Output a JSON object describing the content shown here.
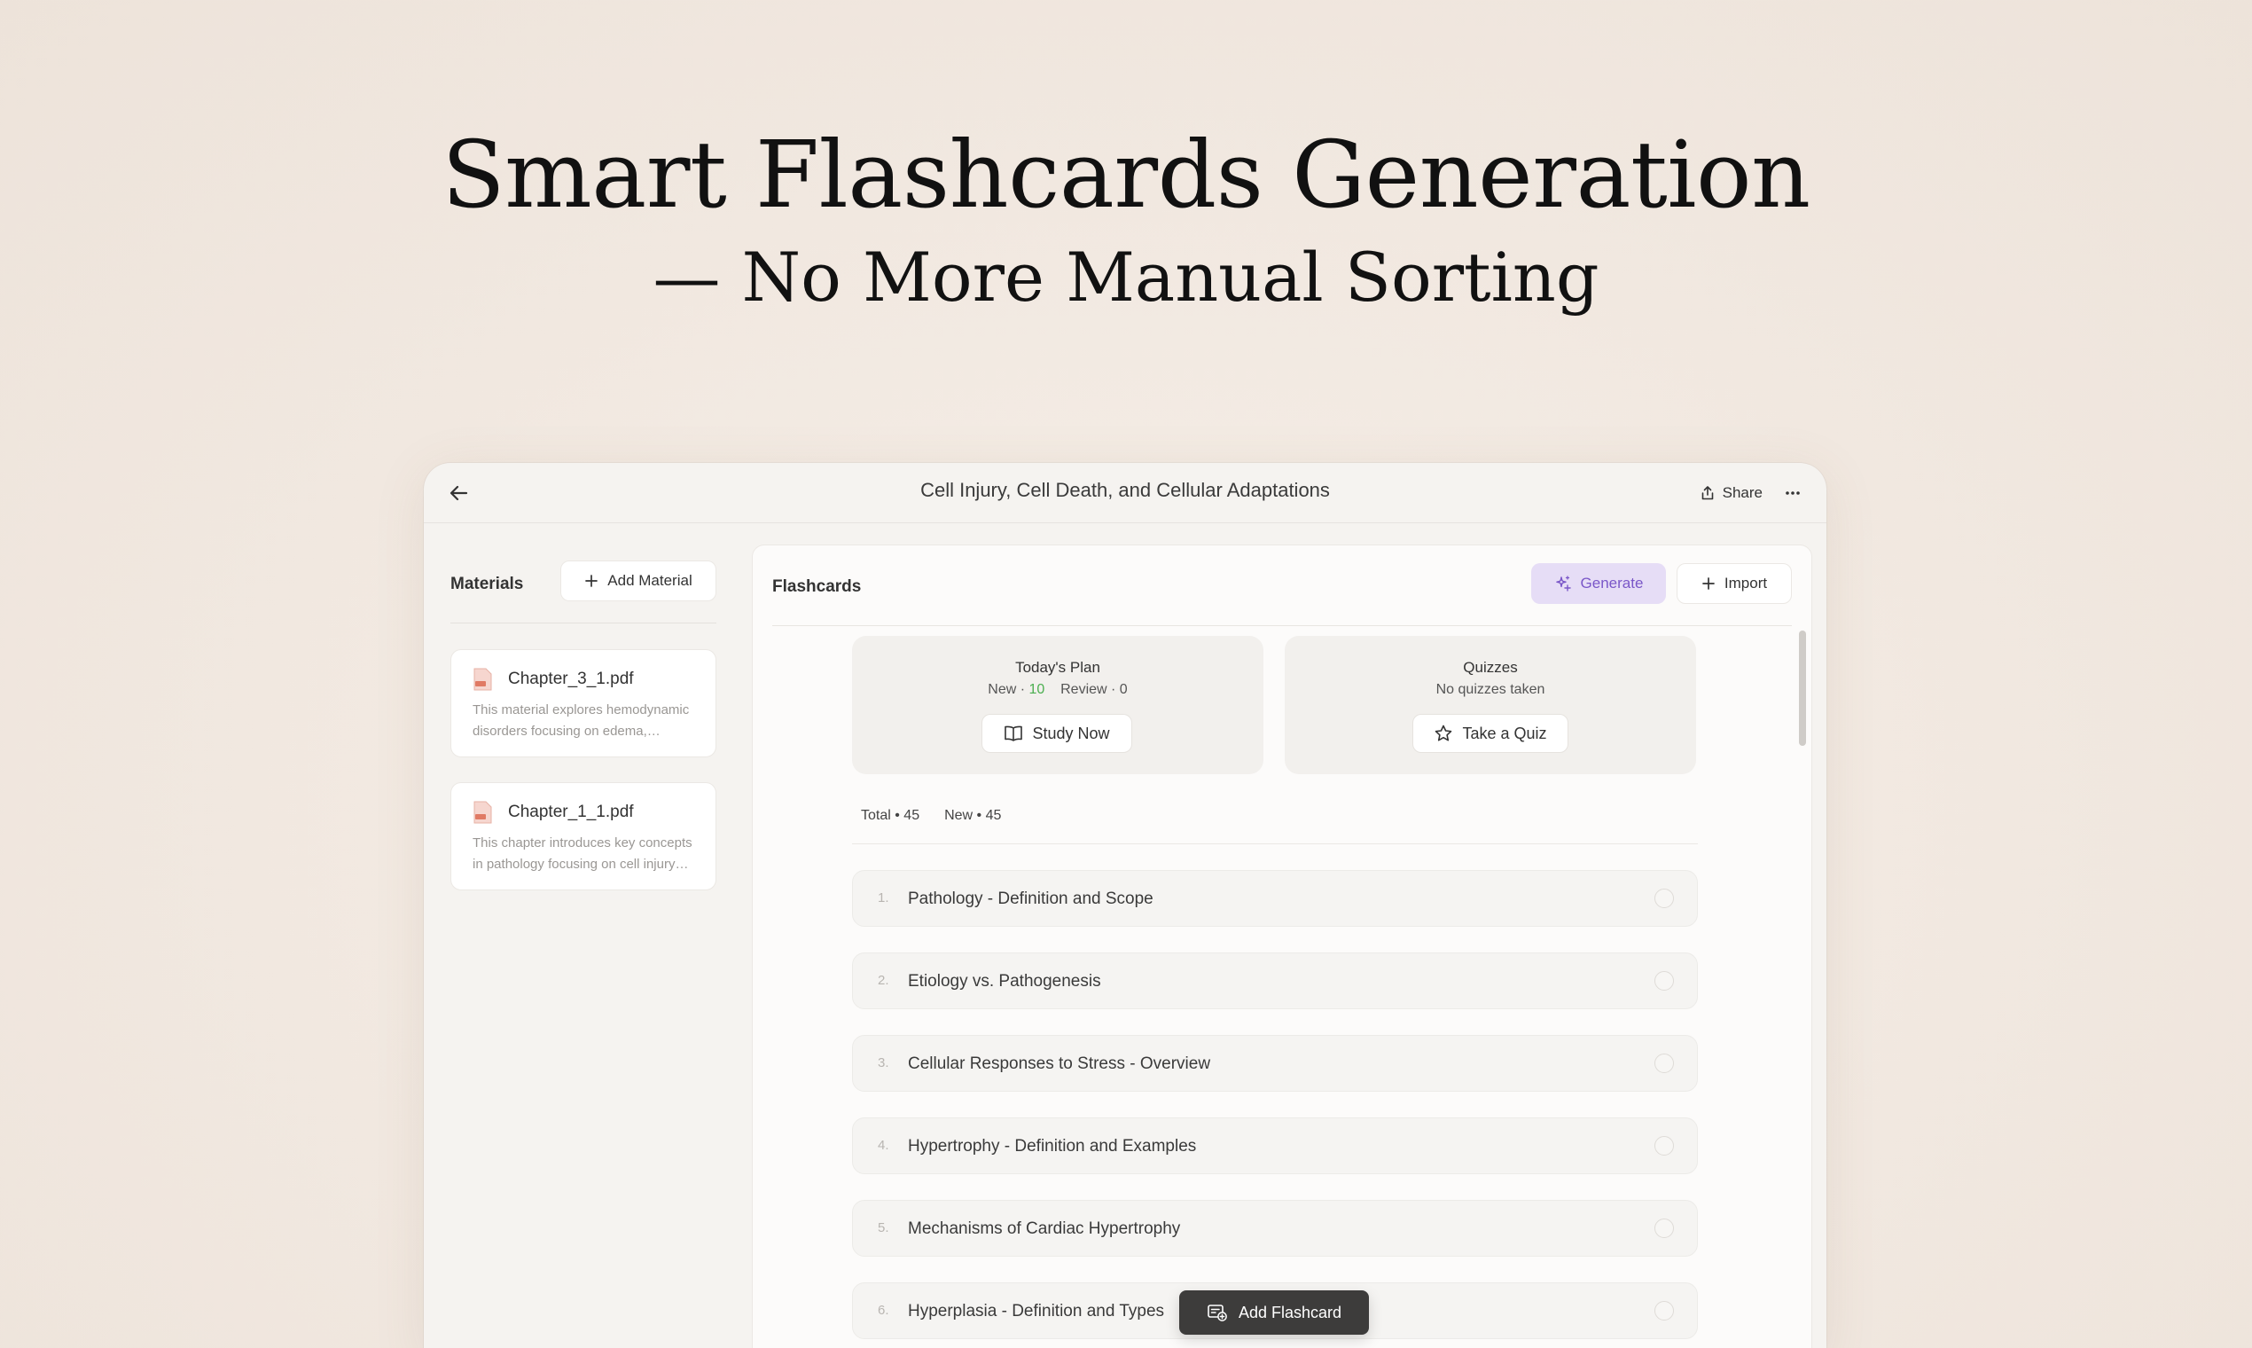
{
  "hero": {
    "headline": "Smart Flashcards Generation",
    "subline": "— No More Manual Sorting"
  },
  "window": {
    "title": "Cell Injury, Cell Death, and Cellular Adaptations",
    "share_label": "Share",
    "icons": {
      "back": "arrow-left-icon",
      "share": "share-icon",
      "more": "ellipsis-icon"
    }
  },
  "materials": {
    "title": "Materials",
    "add_label": "Add Material",
    "items": [
      {
        "name": "Chapter_3_1.pdf",
        "desc": "This material explores hemodynamic disorders focusing on edema, hyperemia and congestion"
      },
      {
        "name": "Chapter_1_1.pdf",
        "desc": "This chapter introduces key concepts in pathology focusing on cell injury and adaptation"
      }
    ]
  },
  "flashcards": {
    "title": "Flashcards",
    "generate_label": "Generate",
    "import_label": "Import",
    "plan": {
      "title": "Today's Plan",
      "new_label": "New ·",
      "new_value": "10",
      "review_label": "Review ·",
      "review_value": "0",
      "button_label": "Study Now"
    },
    "quizzes": {
      "title": "Quizzes",
      "status": "No quizzes taken",
      "button_label": "Take a Quiz"
    },
    "counts": {
      "total": "Total • 45",
      "new": "New • 45"
    },
    "cards": [
      {
        "num": "1.",
        "title": "Pathology - Definition and Scope"
      },
      {
        "num": "2.",
        "title": "Etiology vs. Pathogenesis"
      },
      {
        "num": "3.",
        "title": "Cellular Responses to Stress - Overview"
      },
      {
        "num": "4.",
        "title": "Hypertrophy - Definition and Examples"
      },
      {
        "num": "5.",
        "title": "Mechanisms of Cardiac Hypertrophy"
      },
      {
        "num": "6.",
        "title": "Hyperplasia - Definition and Types"
      }
    ],
    "add_flashcard_label": "Add Flashcard"
  },
  "colors": {
    "accent_purple": "#7a57c8",
    "generate_bg": "#e6ddf6",
    "new_count_green": "#4caf50",
    "dark_button": "#3d3c3b"
  }
}
